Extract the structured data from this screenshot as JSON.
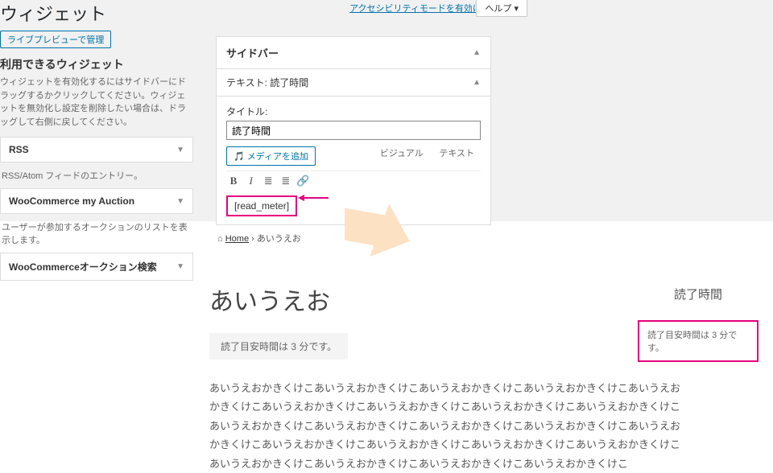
{
  "topLinks": {
    "a11y": "アクセシビリティモードを有効にする",
    "help": "ヘルプ"
  },
  "header": {
    "title": "ウィジェット",
    "livePreview": "ライブプレビューで管理"
  },
  "available": {
    "heading": "利用できるウィジェット",
    "desc": "ウィジェットを有効化するにはサイドバーにドラッグするかクリックしてください。ウィジェットを無効化し設定を削除したい場合は、ドラッグして右側に戻してください。"
  },
  "widgets": [
    {
      "name": "RSS",
      "desc": "RSS/Atom フィードのエントリー。"
    },
    {
      "name": "WooCommerce my Auction",
      "desc": "ユーザーが参加するオークションのリストを表示します。"
    },
    {
      "name": "WooCommerceオークション検索",
      "desc": ""
    }
  ],
  "sidebarPanel": {
    "title": "サイドバー",
    "widgetLabel": "テキスト: 読了時間",
    "titleLabel": "タイトル:",
    "titleValue": "読了時間",
    "addMedia": "メディアを追加",
    "tabVisual": "ビジュアル",
    "tabText": "テキスト",
    "shortcode": "[read_meter]"
  },
  "toolbarIcons": {
    "bold": "B",
    "italic": "I",
    "ul": "≣",
    "ol": "≣",
    "link": "🔗"
  },
  "breadcrumb": {
    "home": "Home",
    "sep": "›",
    "page": "あいうえお"
  },
  "front": {
    "title": "あいうえお",
    "estimate": "読了目安時間は 3 分です。",
    "body": "あいうえおかきくけこあいうえおかきくけこあいうえおかきくけこあいうえおかきくけこあいうえおかきくけこあいうえおかきくけこあいうえおかきくけこあいうえおかきくけこあいうえおかきくけこあいうえおかきくけこあいうえおかきくけこあいうえおかきくけこあいうえおかきくけこあいうえおかきくけこあいうえおかきくけこあいうえおかきくけこあいうえおかきくけこあいうえおかきくけこあいうえおかきくけこあいうえおかきくけこあいうえおかきくけこあいうえおかきくけこ"
  },
  "sideWidget": {
    "title": "読了時間",
    "text": "読了目安時間は 3 分です。"
  }
}
